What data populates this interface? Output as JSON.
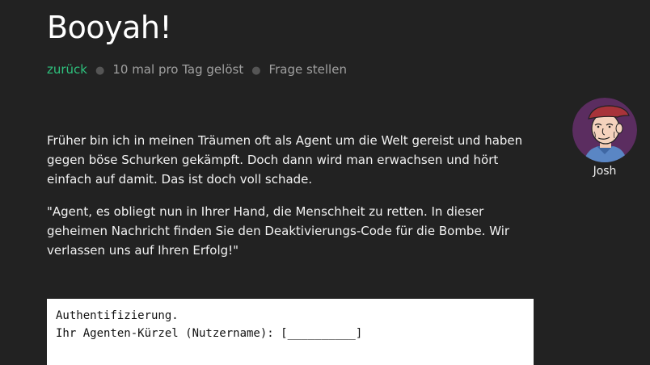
{
  "page": {
    "title": "Booyah!"
  },
  "nav": {
    "back_label": "zurück",
    "solved_label": "10 mal pro Tag gelöst",
    "ask_label": "Frage stellen"
  },
  "content": {
    "paragraph1": "Früher bin ich in meinen Träumen oft als Agent um die Welt gereist und haben gegen böse Schurken gekämpft. Doch dann wird man erwachsen und hört einfach auf damit. Das ist doch voll schade.",
    "paragraph2": "\"Agent, es obliegt nun in Ihrer Hand, die Menschheit zu retten. In dieser geheimen Nachricht finden Sie den Deaktivierungs-Code für die Bombe. Wir verlassen uns auf Ihren Erfolg!\""
  },
  "author": {
    "name": "Josh",
    "avatar_icon": "old-man-portrait-icon"
  },
  "terminal": {
    "line1": "Authentifizierung.",
    "line2": "Ihr Agenten-Kürzel (Nutzername): [__________]"
  },
  "colors": {
    "background": "#222222",
    "accent": "#2ec27e",
    "muted": "#9a9a9a",
    "avatar_bg": "#5b2d60"
  }
}
